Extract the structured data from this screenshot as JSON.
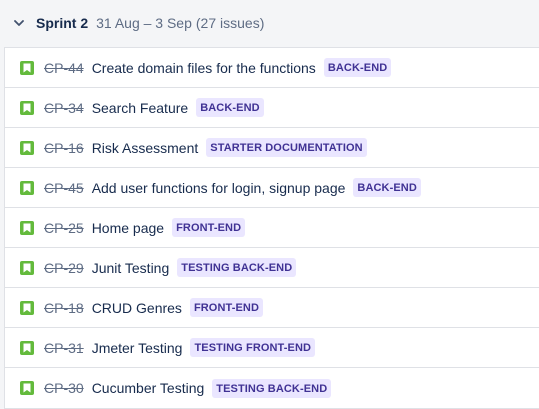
{
  "sprint": {
    "chevron_icon": "chevron-down-icon",
    "name": "Sprint 2",
    "dates": "31 Aug – 3 Sep",
    "issue_count": "(27 issues)"
  },
  "colors": {
    "story_icon": "#63ba3c",
    "epic_label_bg": "#eae6ff",
    "epic_label_text": "#403294"
  },
  "issues": [
    {
      "key": "CP-44",
      "summary": "Create domain files for the functions",
      "epic": "BACK-END",
      "type_icon": "story-icon"
    },
    {
      "key": "CP-34",
      "summary": "Search Feature",
      "epic": "BACK-END",
      "type_icon": "story-icon"
    },
    {
      "key": "CP-16",
      "summary": "Risk Assessment",
      "epic": "STARTER DOCUMENTATION",
      "type_icon": "story-icon"
    },
    {
      "key": "CP-45",
      "summary": "Add user functions for login, signup page",
      "epic": "BACK-END",
      "type_icon": "story-icon"
    },
    {
      "key": "CP-25",
      "summary": "Home page",
      "epic": "FRONT-END",
      "type_icon": "story-icon"
    },
    {
      "key": "CP-29",
      "summary": "Junit Testing",
      "epic": "TESTING BACK-END",
      "type_icon": "story-icon"
    },
    {
      "key": "CP-18",
      "summary": "CRUD Genres",
      "epic": "FRONT-END",
      "type_icon": "story-icon"
    },
    {
      "key": "CP-31",
      "summary": "Jmeter Testing",
      "epic": "TESTING FRONT-END",
      "type_icon": "story-icon"
    },
    {
      "key": "CP-30",
      "summary": "Cucumber Testing",
      "epic": "TESTING BACK-END",
      "type_icon": "story-icon"
    }
  ]
}
